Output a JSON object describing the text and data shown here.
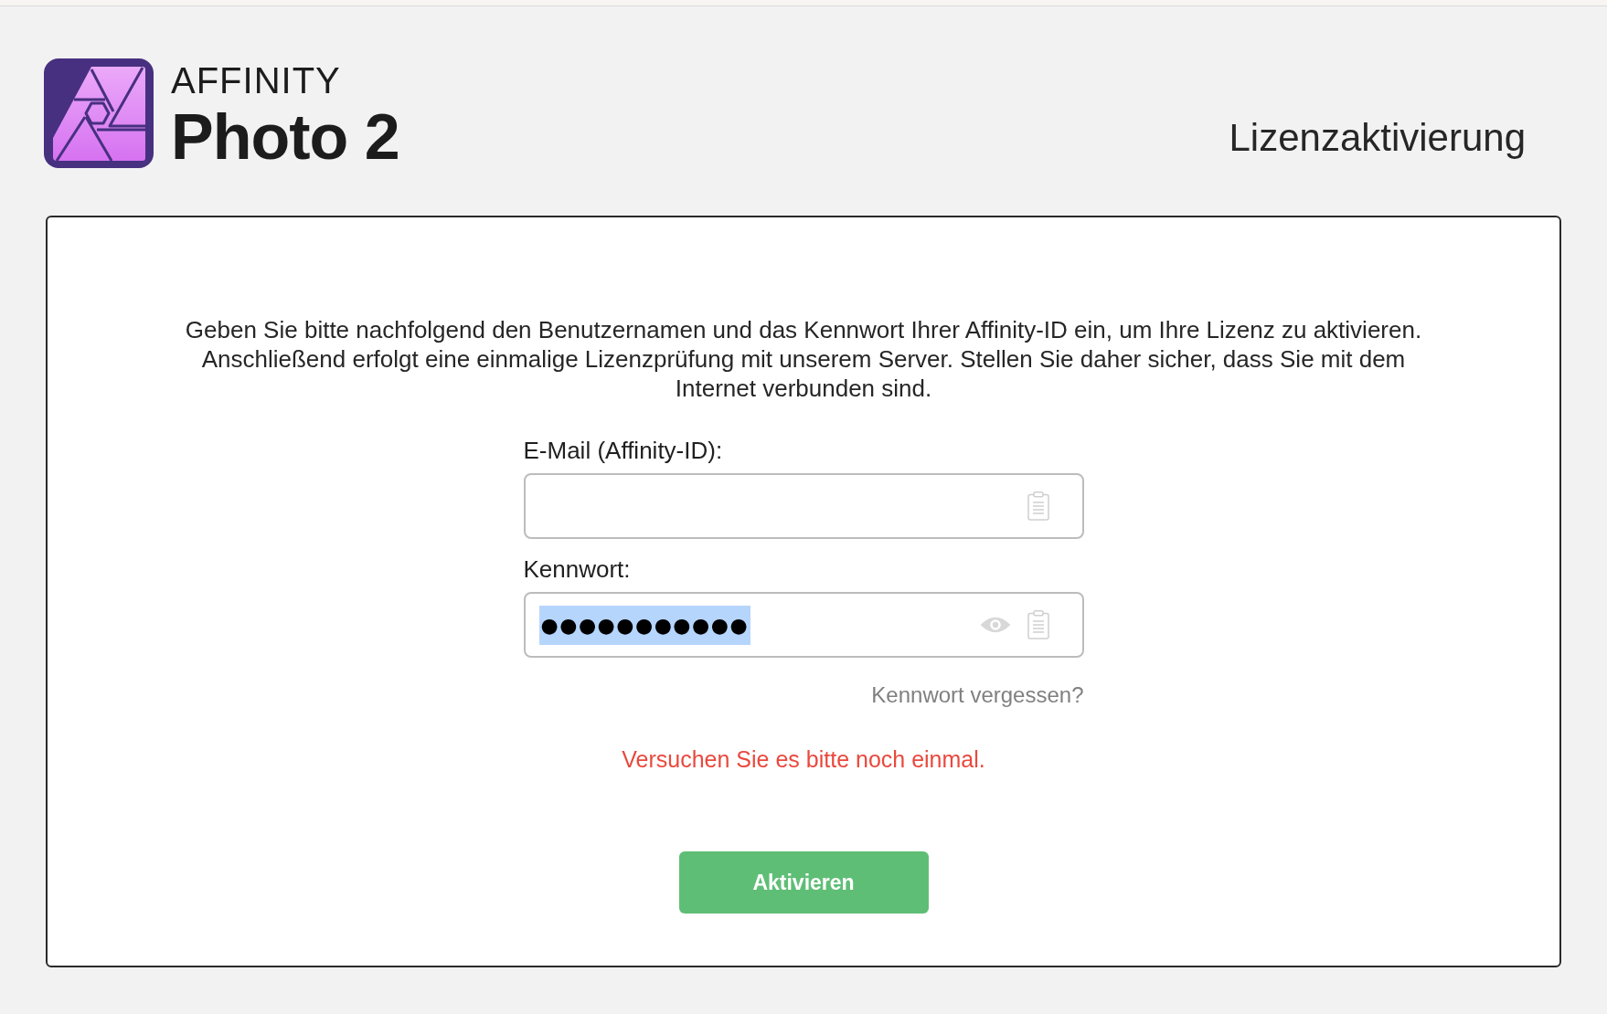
{
  "header": {
    "brand": "AFFINITY",
    "product": "Photo 2",
    "title": "Lizenzaktivierung"
  },
  "panel": {
    "instructions": "Geben Sie bitte nachfolgend den Benutzernamen und das Kennwort Ihrer Affinity-ID ein, um Ihre Lizenz zu aktivieren. Anschließend erfolgt eine einmalige Lizenzprüfung mit unserem Server. Stellen Sie daher sicher, dass Sie mit dem Internet verbunden sind.",
    "fields": [
      {
        "kind": "email",
        "label": "E-Mail (Affinity-ID):"
      },
      {
        "kind": "password",
        "label": "Kennwort:",
        "value": "●●●●●●●●●●●",
        "value_selected": true
      }
    ],
    "forgot_password_link": "Kennwort vergessen?",
    "error_message": "Versuchen Sie es bitte noch einmal.",
    "submit_button": "Aktivieren"
  }
}
